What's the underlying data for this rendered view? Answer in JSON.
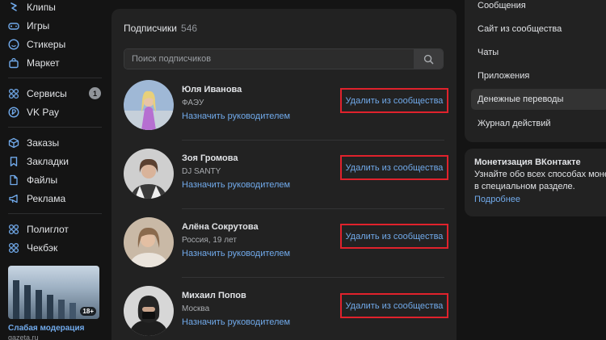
{
  "sidebar": {
    "items": [
      {
        "label": "Клипы",
        "icon": "clips-icon"
      },
      {
        "label": "Игры",
        "icon": "gamepad-icon"
      },
      {
        "label": "Стикеры",
        "icon": "sticker-icon"
      },
      {
        "label": "Маркет",
        "icon": "market-bag-icon"
      },
      {
        "label": "Сервисы",
        "icon": "services-grid-icon",
        "badge": "1"
      },
      {
        "label": "VK Pay",
        "icon": "vkpay-icon"
      },
      {
        "label": "Заказы",
        "icon": "box-icon"
      },
      {
        "label": "Закладки",
        "icon": "bookmark-icon"
      },
      {
        "label": "Файлы",
        "icon": "file-icon"
      },
      {
        "label": "Реклама",
        "icon": "megaphone-icon"
      },
      {
        "label": "Полиглот",
        "icon": "app-grid-icon"
      },
      {
        "label": "Чекбэк",
        "icon": "app-grid-icon"
      }
    ],
    "promo": {
      "title": "Слабая модерация",
      "source": "gazeta.ru",
      "age_badge": "18+"
    }
  },
  "subscribers": {
    "title": "Подписчики",
    "count": "546",
    "search_placeholder": "Поиск подписчиков",
    "members": [
      {
        "name": "Юля Иванова",
        "subtitle": "ФАЭУ",
        "assign_label": "Назначить руководителем",
        "remove_label": "Удалить из сообщества"
      },
      {
        "name": "Зоя Громова",
        "subtitle": "DJ SANTY",
        "assign_label": "Назначить руководителем",
        "remove_label": "Удалить из сообщества"
      },
      {
        "name": "Алёна Сокрутова",
        "subtitle": "Россия, 19 лет",
        "assign_label": "Назначить руководителем",
        "remove_label": "Удалить из сообщества"
      },
      {
        "name": "Михаил Попов",
        "subtitle": "Москва",
        "assign_label": "Назначить руководителем",
        "remove_label": "Удалить из сообщества"
      }
    ]
  },
  "right_menu": {
    "items": [
      {
        "label": "Сообщения"
      },
      {
        "label": "Сайт из сообщества"
      },
      {
        "label": "Чаты"
      },
      {
        "label": "Приложения"
      },
      {
        "label": "Денежные переводы",
        "active": true
      },
      {
        "label": "Журнал действий"
      }
    ]
  },
  "monetization": {
    "title": "Монетизация ВКонтакте",
    "text_line1": "Узнайте обо всех способах монет",
    "text_line2": "в специальном разделе.",
    "link": "Подробнее"
  },
  "colors": {
    "background": "#141414",
    "card": "#222222",
    "accent_link": "#71aaeb",
    "highlight_border": "#e0222c",
    "text_primary": "#e1e3e6",
    "text_secondary": "#909499"
  }
}
